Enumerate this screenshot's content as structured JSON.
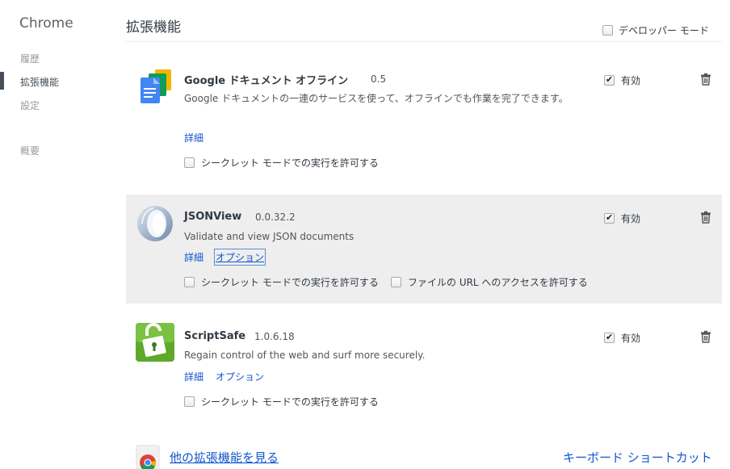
{
  "sidebar": {
    "title": "Chrome",
    "items": [
      {
        "label": "履歴"
      },
      {
        "label": "拡張機能"
      },
      {
        "label": "設定"
      },
      {
        "label": "概要"
      }
    ]
  },
  "header": {
    "title": "拡張機能",
    "developer_mode_label": "デベロッパー モード"
  },
  "extensions": [
    {
      "name": "Google ドキュメント オフライン",
      "version": "0.5",
      "description": "Google ドキュメントの一連のサービスを使って、オフラインでも作業を完了できます。",
      "details_label": "詳細",
      "incognito_label": "シークレット モードでの実行を許可する",
      "enabled_label": "有効",
      "icon": "google-docs-icon"
    },
    {
      "name": "JSONView",
      "version": "0.0.32.2",
      "description": "Validate and view JSON documents",
      "details_label": "詳細",
      "options_label": "オプション",
      "incognito_label": "シークレット モードでの実行を許可する",
      "file_access_label": "ファイルの URL へのアクセスを許可する",
      "enabled_label": "有効",
      "icon": "jsonview-icon"
    },
    {
      "name": "ScriptSafe",
      "version": "1.0.6.18",
      "description": "Regain control of the web and surf more securely.",
      "details_label": "詳細",
      "options_label": "オプション",
      "incognito_label": "シークレット モードでの実行を許可する",
      "enabled_label": "有効",
      "icon": "scriptsafe-lock-icon"
    }
  ],
  "footer": {
    "more_extensions_label": "他の拡張機能を見る",
    "keyboard_shortcuts_label": "キーボード ショートカット"
  },
  "colors": {
    "link": "#1155cc",
    "highlight_row": "#eeeeee",
    "scriptsafe_green": "#5ea82b"
  }
}
